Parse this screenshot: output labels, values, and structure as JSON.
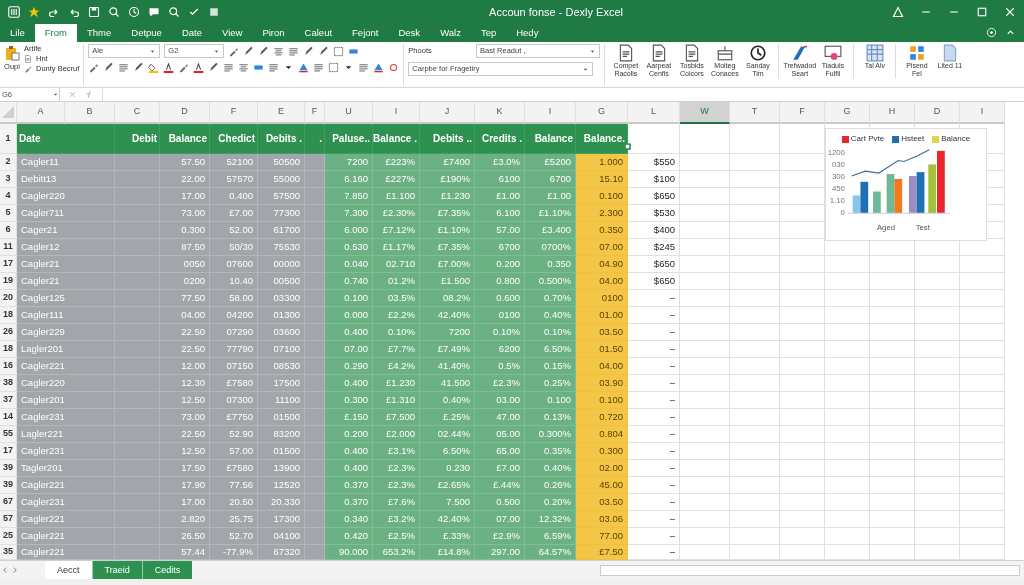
{
  "window": {
    "title": "Accoun fonse - Dexly Excel"
  },
  "ribbon_tabs": [
    {
      "label": "Lile",
      "selected": false
    },
    {
      "label": "From",
      "selected": true
    },
    {
      "label": "Thme",
      "selected": false
    },
    {
      "label": "Detpue",
      "selected": false
    },
    {
      "label": "Date",
      "selected": false
    },
    {
      "label": "View",
      "selected": false
    },
    {
      "label": "Piron",
      "selected": false
    },
    {
      "label": "Caleut",
      "selected": false
    },
    {
      "label": "Fejont",
      "selected": false
    },
    {
      "label": "Desk",
      "selected": false
    },
    {
      "label": "Walz",
      "selected": false
    },
    {
      "label": "Tep",
      "selected": false
    },
    {
      "label": "Hedy",
      "selected": false
    }
  ],
  "ribbon": {
    "paste_label": "Oupi",
    "clipboard_items": [
      "Artife",
      "Hnt",
      "Dunty Becruf"
    ],
    "font_name": "Ale",
    "font_size": "G2",
    "styles_label": "Phoots",
    "style_dropdowns": [
      "Bast Readut ,",
      "Carpbe for Fragetiry"
    ],
    "big_buttons": [
      "Compet Racolis",
      "Aarpeat Cenfis",
      "Tosbids Colcors",
      "Moiteg Conaces",
      "Sanday Tim",
      "Trefwadod Seart",
      "Tiaduls Fulfil",
      "Tal Alv",
      "Pisend Fel",
      "Lited 11"
    ]
  },
  "name_box": "G6",
  "column_headers": [
    {
      "label": "A",
      "selected": false
    },
    {
      "label": "B",
      "selected": false
    },
    {
      "label": "C",
      "selected": false
    },
    {
      "label": "D",
      "selected": false
    },
    {
      "label": "F",
      "selected": false
    },
    {
      "label": "E",
      "selected": false
    },
    {
      "label": "F",
      "selected": false
    },
    {
      "label": "U",
      "selected": false
    },
    {
      "label": "I",
      "selected": false
    },
    {
      "label": "J",
      "selected": false
    },
    {
      "label": "K",
      "selected": false
    },
    {
      "label": "I",
      "selected": false
    },
    {
      "label": "G",
      "selected": false
    },
    {
      "label": "L",
      "selected": false
    },
    {
      "label": "W",
      "selected": true
    },
    {
      "label": "T",
      "selected": false
    },
    {
      "label": "F",
      "selected": false
    },
    {
      "label": "G",
      "selected": false
    },
    {
      "label": "H",
      "selected": false
    },
    {
      "label": "D",
      "selected": false
    },
    {
      "label": "I",
      "selected": false
    }
  ],
  "table": {
    "header_row": "1",
    "columns": [
      {
        "header": "Date",
        "kind": "gray"
      },
      {
        "kind": "gray"
      },
      {
        "header": "Debit",
        "kind": "gray"
      },
      {
        "header": "Balance",
        "kind": "gray"
      },
      {
        "header": "Chedict",
        "kind": "gray"
      },
      {
        "header": "Debits .",
        "kind": "gray"
      },
      {
        "header": ".",
        "kind": "gray"
      },
      {
        "header": "Paluse..",
        "kind": "green"
      },
      {
        "header": "Balance .",
        "kind": "green"
      },
      {
        "header": "Debits ..",
        "kind": "green"
      },
      {
        "header": "Credits .",
        "kind": "green"
      },
      {
        "header": "Balance",
        "kind": "green"
      },
      {
        "header": "Balance.",
        "kind": "yellow"
      }
    ],
    "rows": [
      {
        "row": "2",
        "name": "Cagler11",
        "values": [
          "57.50",
          "52100",
          "50500",
          "7200",
          "£223%",
          "£7400",
          "£3.0%",
          "£5200",
          "1.000"
        ],
        "total": "$550"
      },
      {
        "row": "3",
        "name": "Debitt13",
        "values": [
          "22.00",
          "57570",
          "55000",
          "6.160",
          "£227%",
          "£190%",
          "6100",
          "6700",
          "15.10"
        ],
        "total": "$100"
      },
      {
        "row": "4",
        "name": "Cagler220",
        "values": [
          "17.00",
          "0.400",
          "57500",
          "7.850",
          "£1.100",
          "£1.230",
          "£1.00",
          "£1.00",
          "0.100"
        ],
        "total": "$650"
      },
      {
        "row": "5",
        "name": "Cagler711",
        "values": [
          "73.00",
          "£7.00",
          "77300",
          "7.300",
          "£2.30%",
          "£7.35%",
          "6.100",
          "£1.10%",
          "2.300"
        ],
        "total": "$530"
      },
      {
        "row": "6",
        "name": "Cager21",
        "values": [
          "0.300",
          "52.00",
          "61700",
          "6.000",
          "£7.12%",
          "£1.10%",
          "57.00",
          "£3.400",
          "0.350"
        ],
        "total": "$400"
      },
      {
        "row": "11",
        "name": "Cagler12",
        "values": [
          "87.50",
          "50/30",
          "75530",
          "0.530",
          "£1.17%",
          "£7.35%",
          "6700",
          "0700%",
          "07.00"
        ],
        "total": "$245"
      },
      {
        "row": "17",
        "name": "Cagler21",
        "values": [
          "0050",
          "07600",
          "00000",
          "0.040",
          "02.710",
          "£7.00%",
          "0.200",
          "0.350",
          "04.90"
        ],
        "total": "$650"
      },
      {
        "row": "19",
        "name": "Cagler21",
        "values": [
          "0200",
          "10.40",
          "00500",
          "0.740",
          "01.2%",
          "£1.500",
          "0.800",
          "0.500%",
          "04.00"
        ],
        "total": "$650"
      },
      {
        "row": "20",
        "name": "Cagler125",
        "values": [
          "77.50",
          "58.00",
          "03300",
          "0.100",
          "03.5%",
          "08.2%",
          "0.600",
          "0.70%",
          "0100"
        ],
        "total": "–"
      },
      {
        "row": "18",
        "name": "Cagler111",
        "values": [
          "04.00",
          "04200",
          "01300",
          "0.000",
          "£2.2%",
          "42.40%",
          "0100",
          "0.40%",
          "01.00"
        ],
        "total": "–"
      },
      {
        "row": "26",
        "name": "Cagler229",
        "values": [
          "22.50",
          "07290",
          "03600",
          "0.400",
          "0.10%",
          "7200",
          "0.10%",
          "0.10%",
          "03.50"
        ],
        "total": "–"
      },
      {
        "row": "18",
        "name": "Lagler201",
        "values": [
          "22.50",
          "77790",
          "07100",
          "07.00",
          "£7.7%",
          "£7.49%",
          "6200",
          "6.50%",
          "01.50"
        ],
        "total": "–"
      },
      {
        "row": "16",
        "name": "Cagler221",
        "values": [
          "12.00",
          "07150",
          "08530",
          "0.290",
          "£4.2%",
          "41.40%",
          "0.5%",
          "0.15%",
          "04.00"
        ],
        "total": "–"
      },
      {
        "row": "38",
        "name": "Cagler220",
        "values": [
          "12.30",
          "£7580",
          "17500",
          "0.400",
          "£1.230",
          "41.500",
          "£2.3%",
          "0.25%",
          "03.90"
        ],
        "total": "–"
      },
      {
        "row": "37",
        "name": "Cagler201",
        "values": [
          "12.50",
          "07300",
          "11100",
          "0.300",
          "£1.310",
          "0.40%",
          "03.00",
          "0.100",
          "0.100"
        ],
        "total": "–"
      },
      {
        "row": "14",
        "name": "Cagler231",
        "values": [
          "73.00",
          "£7750",
          "01500",
          "£.150",
          "£7.500",
          "£.25%",
          "47.00",
          "0.13%",
          "0.720"
        ],
        "total": "–"
      },
      {
        "row": "55",
        "name": "Lagler221",
        "values": [
          "22.50",
          "52.90",
          "83200",
          "0.200",
          "£2.000",
          "02.44%",
          "05.00",
          "0.300%",
          "0.804"
        ],
        "total": "–"
      },
      {
        "row": "17",
        "name": "Cagler231",
        "values": [
          "12.50",
          "57.00",
          "01500",
          "0.400",
          "£3.1%",
          "6.50%",
          "65.00",
          "0.35%",
          "0.300"
        ],
        "total": "–"
      },
      {
        "row": "39",
        "name": "Tagler201",
        "values": [
          "17.50",
          "£7580",
          "13900",
          "0.400",
          "£2.3%",
          "0.230",
          "£7.00",
          "0.40%",
          "02.00"
        ],
        "total": "–"
      },
      {
        "row": "39",
        "name": "Cagler221",
        "values": [
          "17.90",
          "77.56",
          "12520",
          "0.370",
          "£2.3%",
          "£2.65%",
          "£.44%",
          "0.26%",
          "45.00"
        ],
        "total": "–"
      },
      {
        "row": "67",
        "name": "Cagler231",
        "values": [
          "17.00",
          "20.50",
          "20.330",
          "0.370",
          "£7.6%",
          "7.500",
          "0.500",
          "0.20%",
          "03.50"
        ],
        "total": "–"
      },
      {
        "row": "57",
        "name": "Cagler221",
        "values": [
          "2.820",
          "25.75",
          "17300",
          "0.340",
          "£3.2%",
          "42.40%",
          "07.00",
          "12.32%",
          "03.06"
        ],
        "total": "–"
      },
      {
        "row": "25",
        "name": "Cagler221",
        "values": [
          "26.50",
          "52.70",
          "04100",
          "0.420",
          "£2.5%",
          "£.33%",
          "£2.9%",
          "6.59%",
          "77.00"
        ],
        "total": "–"
      },
      {
        "row": "35",
        "name": "Cagler221",
        "values": [
          "57.44",
          "-77.9%",
          "67320",
          "90.000",
          "653.2%",
          "£14.8%",
          "297.00",
          "64.57%",
          "£7.50"
        ],
        "total": "–"
      }
    ]
  },
  "chart": {
    "legend": [
      {
        "label": "Cart Pvte",
        "color": "#e8262b"
      },
      {
        "label": "Hsteet",
        "color": "#1f6fb5"
      },
      {
        "label": "Balance",
        "color": "#e3d34e"
      }
    ],
    "y_tick_labels": [
      "1200",
      "030",
      "300",
      "450",
      "1.10",
      "0"
    ],
    "x_labels": [
      "Aged",
      "Test"
    ]
  },
  "sheet_tabs": [
    {
      "label": "Aecct",
      "selected": true
    },
    {
      "label": "Traeid",
      "selected": false
    },
    {
      "label": "Cedits",
      "selected": false
    }
  ]
}
